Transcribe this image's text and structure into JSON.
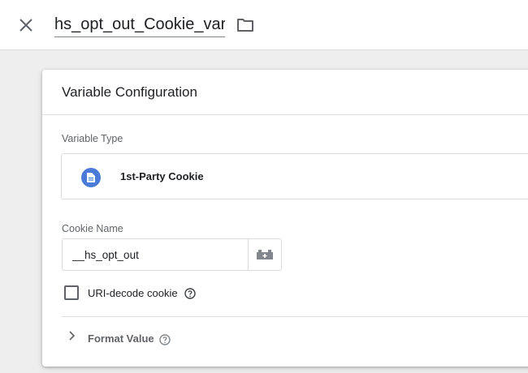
{
  "header": {
    "variable_name": "hs_opt_out_Cookie_var",
    "close_icon": "close-icon",
    "folder_icon": "folder-icon"
  },
  "card": {
    "title": "Variable Configuration",
    "variable_type": {
      "label": "Variable Type",
      "selected": "1st-Party Cookie",
      "icon": "document-icon",
      "icon_color": "#4a7bd8"
    },
    "cookie_name": {
      "label": "Cookie Name",
      "value": "__hs_opt_out",
      "picker_icon": "variable-picker-icon"
    },
    "uri_decode": {
      "label": "URI-decode cookie",
      "checked": false,
      "help_icon": "help-icon"
    },
    "format_value": {
      "label": "Format Value",
      "expanded": false,
      "help_icon": "help-icon"
    }
  }
}
